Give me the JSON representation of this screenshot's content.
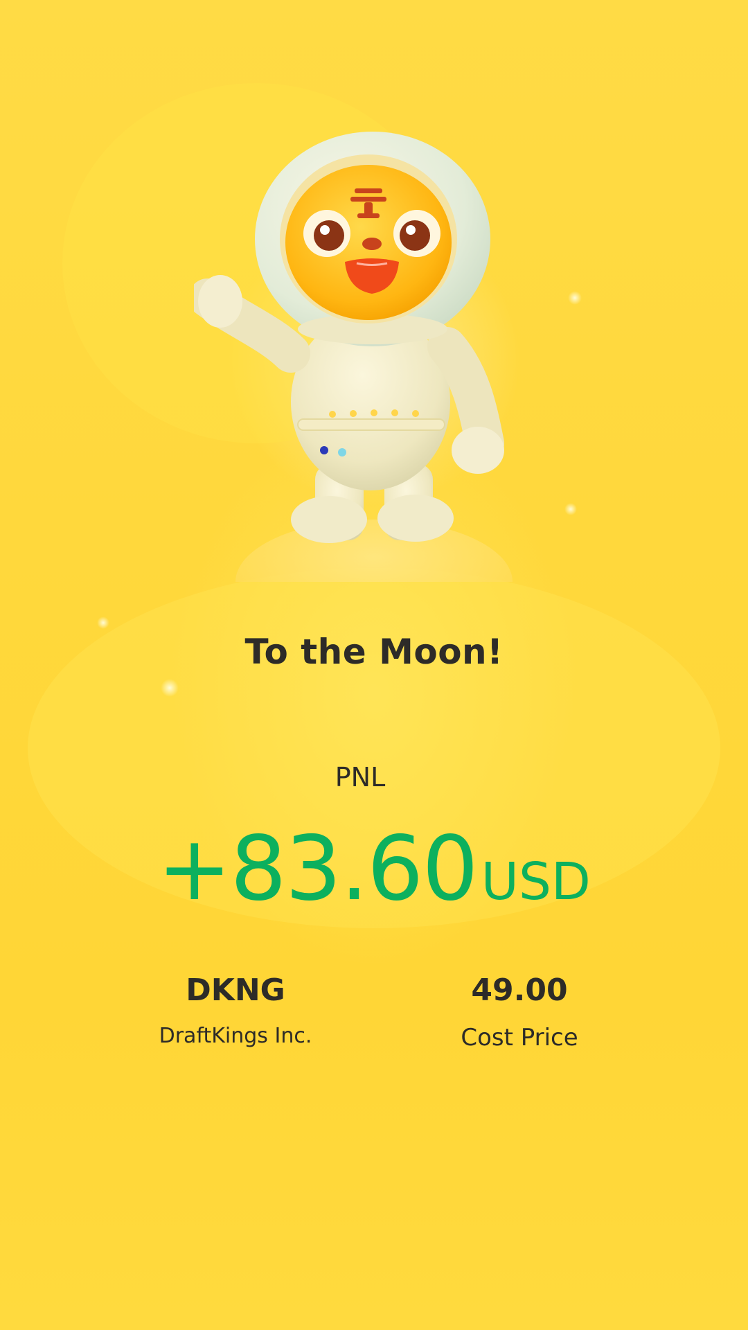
{
  "headline": "To the Moon!",
  "pnl": {
    "label": "PNL",
    "value": "+83.60",
    "unit": "USD",
    "color": "#0cb05e"
  },
  "stock": {
    "ticker": "DKNG",
    "name": "DraftKings Inc."
  },
  "cost": {
    "value": "49.00",
    "label": "Cost Price"
  },
  "colors": {
    "background": "#ffd83a",
    "text": "#2d2b28"
  },
  "illustration": "astronaut-tiger-mascot"
}
